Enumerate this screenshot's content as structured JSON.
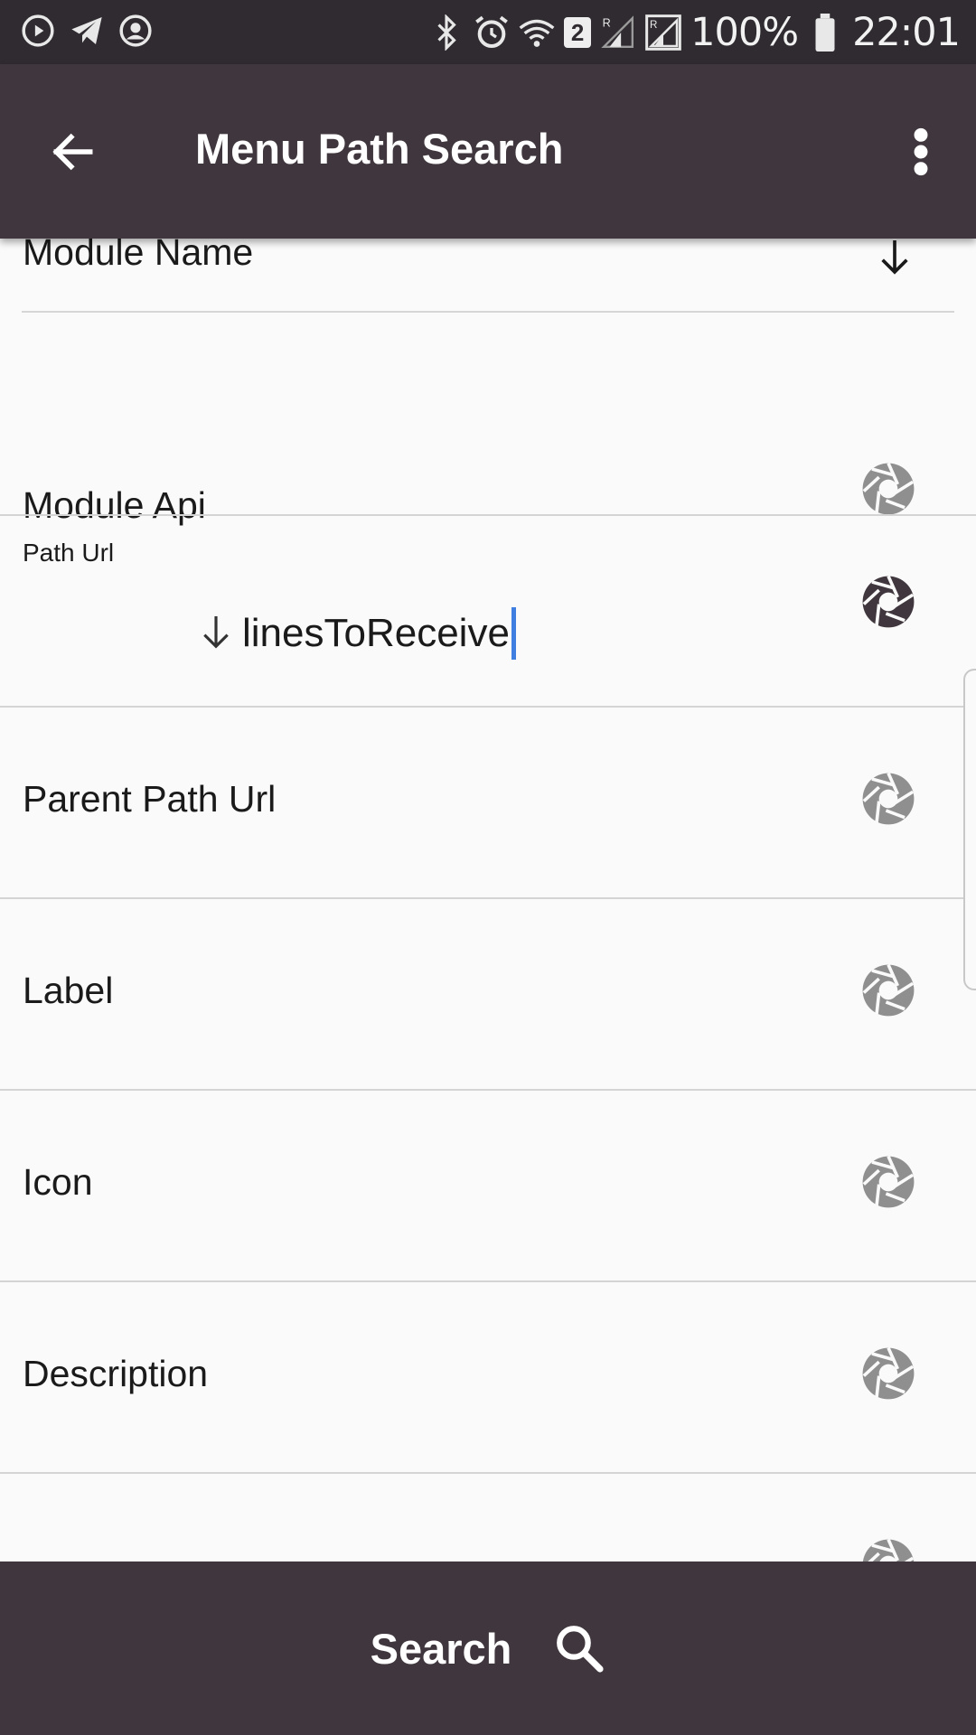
{
  "status_bar": {
    "battery_percent": "100%",
    "time": "22:01",
    "sim_badge": "2",
    "left_icons": [
      "play-circle-icon",
      "telegram-icon",
      "account-circle-icon"
    ],
    "right_icons": [
      "bluetooth-icon",
      "alarm-icon",
      "wifi-icon",
      "signal-icon",
      "signal-roaming-icon",
      "battery-icon"
    ]
  },
  "app_bar": {
    "title": "Menu Path Search",
    "back_icon": "arrow-back-icon",
    "menu_icon": "more-vert-icon"
  },
  "fields": {
    "module_name": {
      "label": "Module Name",
      "icon": "arrow-down-icon"
    },
    "module_api": {
      "label": "Module Api",
      "icon": "camera-shutter-icon"
    },
    "path_url": {
      "label": "Path Url",
      "value": "linesToReceive",
      "icon": "camera-shutter-icon"
    },
    "parent_path_url": {
      "label": "Parent Path Url",
      "icon": "camera-shutter-icon"
    },
    "label": {
      "label": "Label",
      "icon": "camera-shutter-icon"
    },
    "icon": {
      "label": "Icon",
      "icon": "camera-shutter-icon"
    },
    "description": {
      "label": "Description",
      "icon": "camera-shutter-icon"
    }
  },
  "bottom_bar": {
    "search_label": "Search",
    "search_icon": "search-icon"
  },
  "colors": {
    "app_bar": "#40363d",
    "status_bar": "#2f2b30",
    "background": "#fafafa",
    "icon_inactive": "#8f8f8f",
    "icon_active": "#40363d",
    "caret": "#3f7fe0"
  }
}
